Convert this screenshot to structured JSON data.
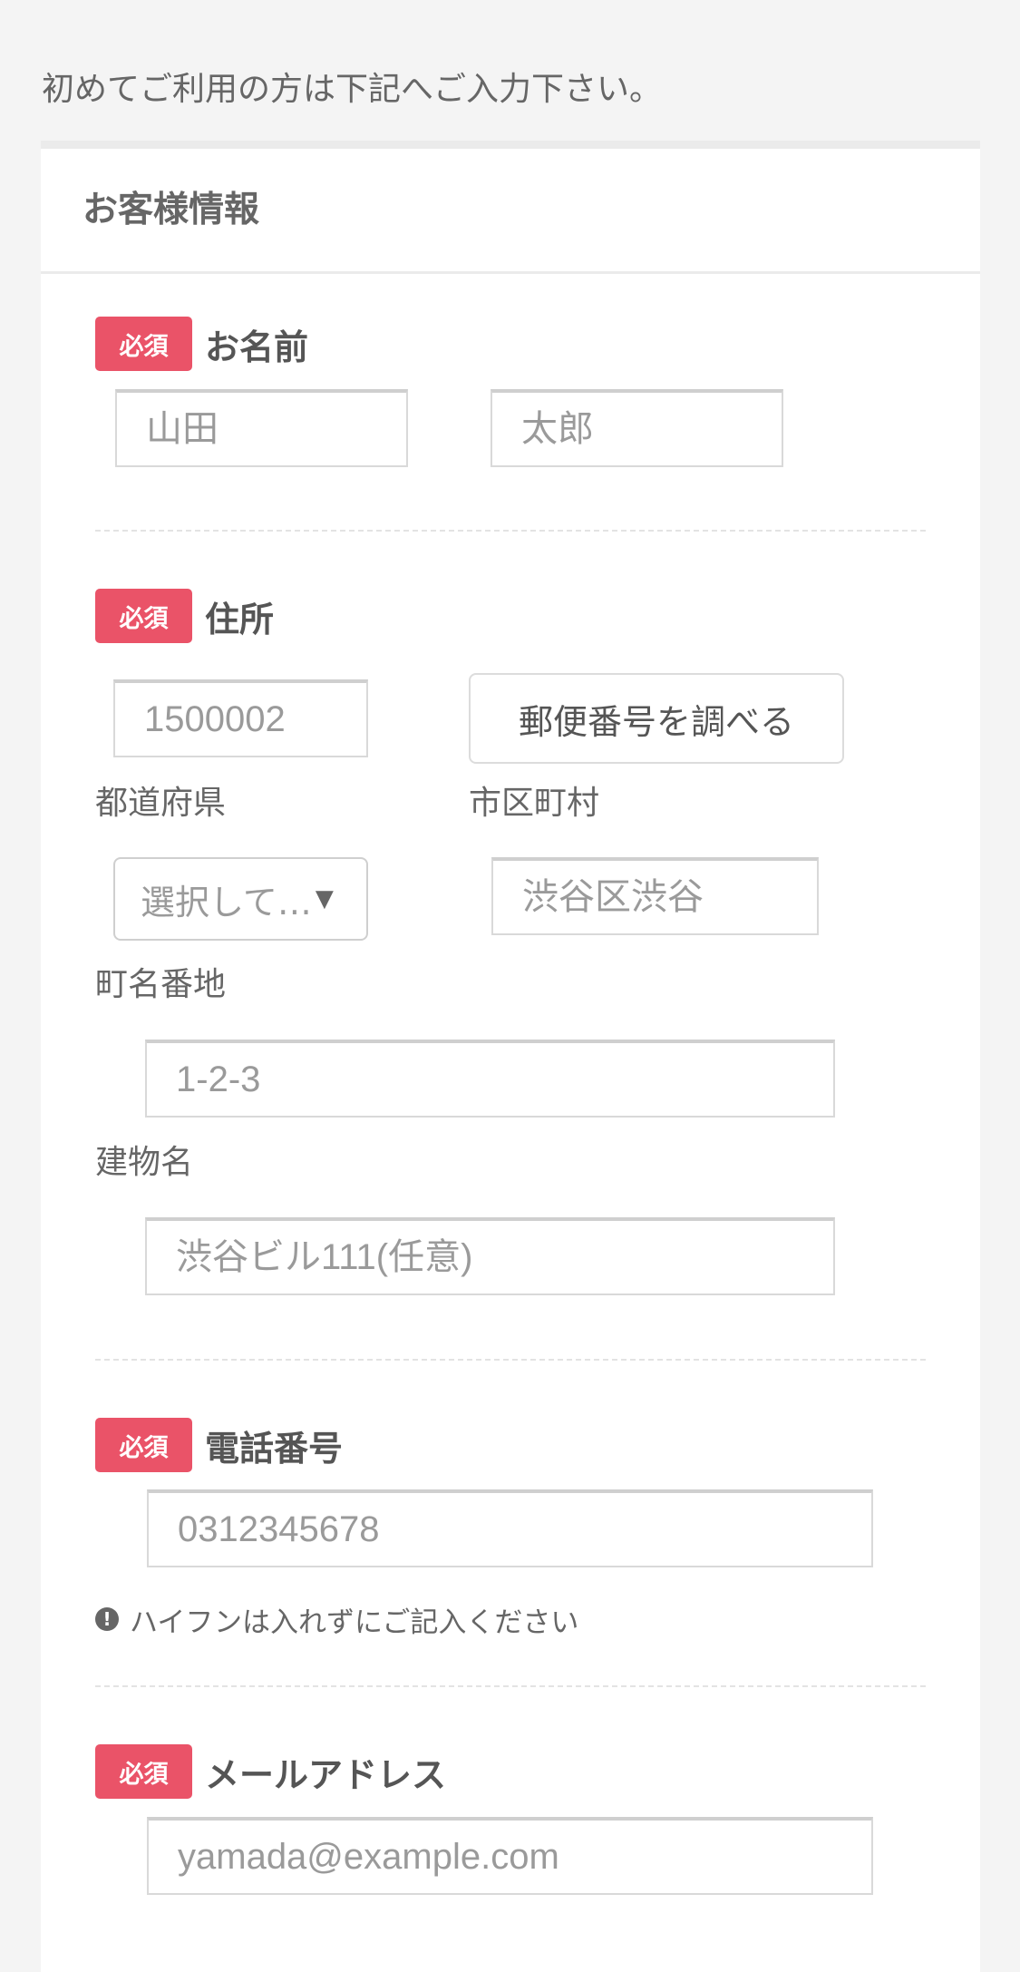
{
  "intro_text": "初めてご利用の方は下記へご入力下さい。",
  "card": {
    "title": "お客様情報"
  },
  "required_badge": "必須",
  "name_section": {
    "title": "お名前",
    "last_name_placeholder": "山田",
    "first_name_placeholder": "太郎"
  },
  "address_section": {
    "title": "住所",
    "postal_placeholder": "1500002",
    "postal_lookup_button": "郵便番号を調べる",
    "prefecture_label": "都道府県",
    "prefecture_select_value": "選択して…",
    "city_label": "市区町村",
    "city_placeholder": "渋谷区渋谷",
    "street_label": "町名番地",
    "street_placeholder": "1-2-3",
    "building_label": "建物名",
    "building_placeholder": "渋谷ビル111(任意)"
  },
  "phone_section": {
    "title": "電話番号",
    "placeholder": "0312345678",
    "note": "ハイフンは入れずにご記入ください",
    "note_icon": "exclamation-circle-icon"
  },
  "email_section": {
    "title": "メールアドレス",
    "placeholder": "yamada@example.com"
  },
  "colors": {
    "badge": "#ea5368",
    "background": "#f4f4f4",
    "card": "#ffffff"
  }
}
